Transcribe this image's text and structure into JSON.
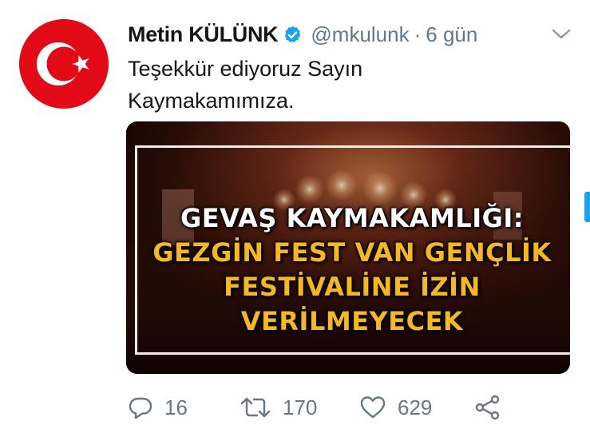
{
  "tweet": {
    "author_name": "Metin KÜLÜNK",
    "handle": "@mkulunk",
    "separator": "·",
    "time": "6 gün",
    "text": "Teşekkür ediyoruz Sayın Kaymakamımıza.",
    "media": {
      "line1": "GEVAŞ KAYMAKAMLIĞI:",
      "line2": "GEZGİN FEST VAN GENÇLİK",
      "line3": "FESTİVALİNE İZİN VERİLMEYECEK"
    },
    "actions": {
      "reply_count": "16",
      "retweet_count": "170",
      "like_count": "629"
    }
  },
  "icons": {
    "avatar": "turkish-flag-icon",
    "verified": "verified-badge-icon",
    "caret": "chevron-down-icon",
    "reply": "reply-icon",
    "retweet": "retweet-icon",
    "like": "heart-icon",
    "share": "share-icon"
  },
  "colors": {
    "name": "#14171a",
    "secondary": "#657786",
    "verified": "#1da1f2",
    "flag_red": "#e30a17",
    "headline_white": "#ffffff",
    "headline_yellow": "#f5b823"
  }
}
